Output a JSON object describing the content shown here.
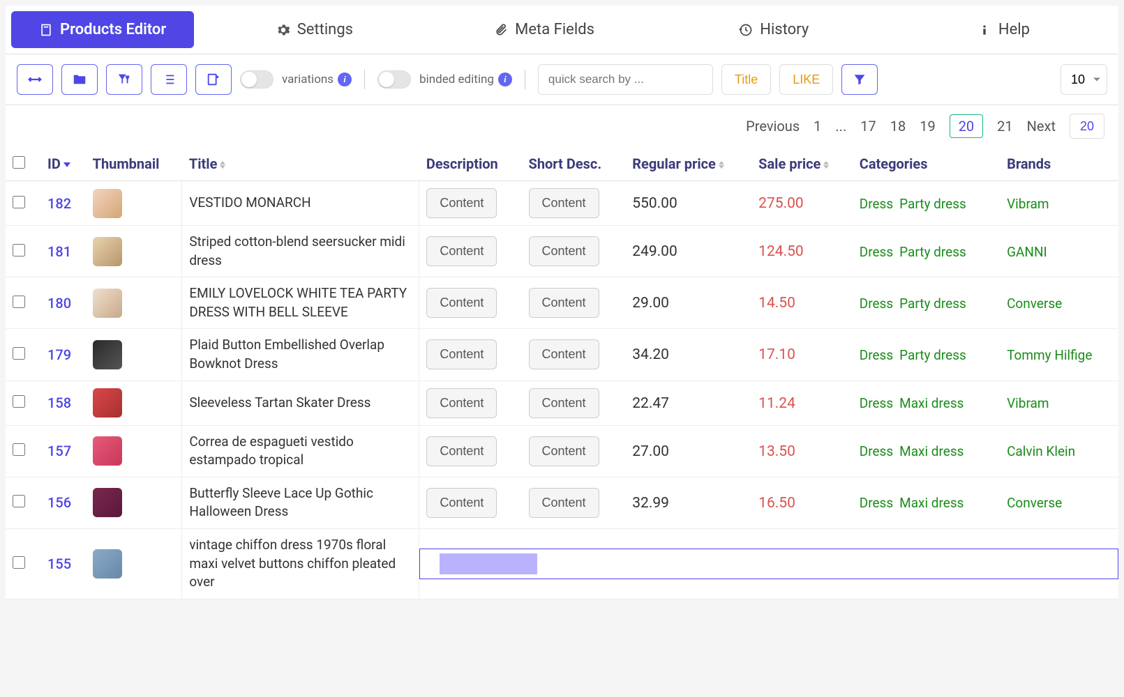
{
  "tabs": {
    "products": "Products Editor",
    "settings": "Settings",
    "meta": "Meta Fields",
    "history": "History",
    "help": "Help"
  },
  "toolbar": {
    "variations_label": "variations",
    "binded_label": "binded editing",
    "search_placeholder": "quick search by ...",
    "filter_title": "Title",
    "filter_like": "LIKE",
    "page_size": "10"
  },
  "pagination": {
    "previous": "Previous",
    "next": "Next",
    "pages": [
      "1",
      "...",
      "17",
      "18",
      "19",
      "20",
      "21"
    ],
    "current": "20",
    "goto": "20"
  },
  "columns": {
    "id": "ID",
    "thumbnail": "Thumbnail",
    "title": "Title",
    "description": "Description",
    "short_desc": "Short Desc.",
    "regular_price": "Regular price",
    "sale_price": "Sale price",
    "categories": "Categories",
    "brands": "Brands"
  },
  "content_btn": "Content",
  "rows": [
    {
      "id": "182",
      "title": "VESTIDO MONARCH",
      "price": "550.00",
      "sale": "275.00",
      "cats": [
        "Dress",
        "Party dress"
      ],
      "brand": "Vibram",
      "thumb": "t1"
    },
    {
      "id": "181",
      "title": "Striped cotton-blend seersucker midi dress",
      "price": "249.00",
      "sale": "124.50",
      "cats": [
        "Dress",
        "Party dress"
      ],
      "brand": "GANNI",
      "thumb": "t2"
    },
    {
      "id": "180",
      "title": "EMILY LOVELOCK WHITE TEA PARTY DRESS WITH BELL SLEEVE",
      "price": "29.00",
      "sale": "14.50",
      "cats": [
        "Dress",
        "Party dress"
      ],
      "brand": "Converse",
      "thumb": "t3"
    },
    {
      "id": "179",
      "title": "Plaid Button Embellished Overlap Bowknot Dress",
      "price": "34.20",
      "sale": "17.10",
      "cats": [
        "Dress",
        "Party dress"
      ],
      "brand": "Tommy Hilfige",
      "thumb": "t4"
    },
    {
      "id": "158",
      "title": "Sleeveless Tartan Skater Dress",
      "price": "22.47",
      "sale": "11.24",
      "cats": [
        "Dress",
        "Maxi dress"
      ],
      "brand": "Vibram",
      "thumb": "t5"
    },
    {
      "id": "157",
      "title": "Correa de espagueti vestido estampado tropical",
      "price": "27.00",
      "sale": "13.50",
      "cats": [
        "Dress",
        "Maxi dress"
      ],
      "brand": "Calvin Klein",
      "thumb": "t6"
    },
    {
      "id": "156",
      "title": "Butterfly Sleeve Lace Up Gothic Halloween Dress",
      "price": "32.99",
      "sale": "16.50",
      "cats": [
        "Dress",
        "Maxi dress"
      ],
      "brand": "Converse",
      "thumb": "t7"
    },
    {
      "id": "155",
      "title": "vintage chiffon dress 1970s floral maxi velvet buttons chiffon pleated over",
      "price": "",
      "sale": "",
      "cats": [],
      "brand": "",
      "thumb": "t8",
      "editing": true
    }
  ]
}
